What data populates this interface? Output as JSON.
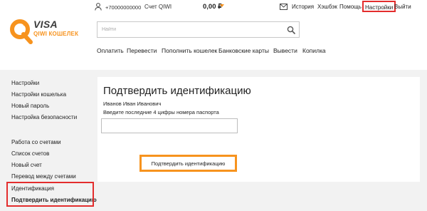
{
  "topbar": {
    "phone": "+70000000000",
    "account_label": "Счет QIWI",
    "balance": "0,00 ₽",
    "links": {
      "history": "История",
      "hashtag": "Хэшбэк",
      "help": "Помощь",
      "settings": "Настройки",
      "logout": "Выйти"
    }
  },
  "logo": {
    "visa": "VISA",
    "wallet": "QIWI КОШЕЛЕК"
  },
  "search": {
    "placeholder": "Найти"
  },
  "mainnav": {
    "items": [
      "Оплатить",
      "Перевести",
      "Пополнить кошелек",
      "Банковские карты",
      "Вывести",
      "Копилка"
    ]
  },
  "sidebar": {
    "group1": [
      "Настройки",
      "Настройки кошелька",
      "Новый пароль",
      "Настройка безопасности"
    ],
    "group2": [
      "Работа со счетами",
      "Список счетов",
      "Новый счет",
      "Перевод между счетами",
      "Идентификация",
      "Подтвердить идентификацию"
    ]
  },
  "panel": {
    "title": "Подтвердить идентификацию",
    "user_name": "Иванов Иван Иванович",
    "hint": "Введите последние 4 цифры номера паспорта",
    "passport_value": "",
    "confirm_label": "Подтвердить идентификацию"
  },
  "colors": {
    "accent_orange": "#f7931e",
    "highlight_red": "#e32d2d",
    "content_bg": "#f2f2f2"
  }
}
